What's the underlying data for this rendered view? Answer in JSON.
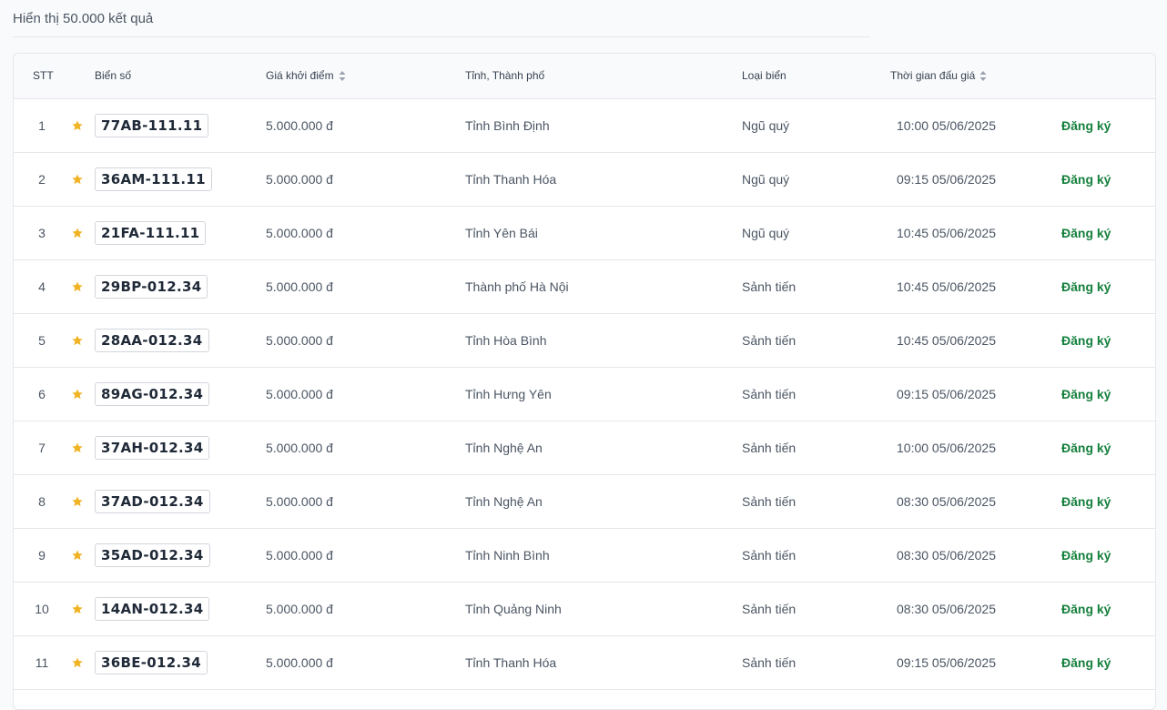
{
  "header": {
    "result_count": "Hiển thị 50.000 kết quả"
  },
  "table": {
    "columns": {
      "stt": "STT",
      "plate": "Biển số",
      "price": "Giá khởi điểm",
      "province": "Tỉnh, Thành phố",
      "type": "Loại biển",
      "time": "Thời gian đấu giá"
    },
    "rows": [
      {
        "stt": "1",
        "plate": "77AB-111.11",
        "price": "5.000.000 đ",
        "province": "Tỉnh Bình Định",
        "type": "Ngũ quý",
        "time": "10:00 05/06/2025",
        "action": "Đăng ký"
      },
      {
        "stt": "2",
        "plate": "36AM-111.11",
        "price": "5.000.000 đ",
        "province": "Tỉnh Thanh Hóa",
        "type": "Ngũ quý",
        "time": "09:15 05/06/2025",
        "action": "Đăng ký"
      },
      {
        "stt": "3",
        "plate": "21FA-111.11",
        "price": "5.000.000 đ",
        "province": "Tỉnh Yên Bái",
        "type": "Ngũ quý",
        "time": "10:45 05/06/2025",
        "action": "Đăng ký"
      },
      {
        "stt": "4",
        "plate": "29BP-012.34",
        "price": "5.000.000 đ",
        "province": "Thành phố Hà Nội",
        "type": "Sảnh tiến",
        "time": "10:45 05/06/2025",
        "action": "Đăng ký"
      },
      {
        "stt": "5",
        "plate": "28AA-012.34",
        "price": "5.000.000 đ",
        "province": "Tỉnh Hòa Bình",
        "type": "Sảnh tiến",
        "time": "10:45 05/06/2025",
        "action": "Đăng ký"
      },
      {
        "stt": "6",
        "plate": "89AG-012.34",
        "price": "5.000.000 đ",
        "province": "Tỉnh Hưng Yên",
        "type": "Sảnh tiến",
        "time": "09:15 05/06/2025",
        "action": "Đăng ký"
      },
      {
        "stt": "7",
        "plate": "37AH-012.34",
        "price": "5.000.000 đ",
        "province": "Tỉnh Nghệ An",
        "type": "Sảnh tiến",
        "time": "10:00 05/06/2025",
        "action": "Đăng ký"
      },
      {
        "stt": "8",
        "plate": "37AD-012.34",
        "price": "5.000.000 đ",
        "province": "Tỉnh Nghệ An",
        "type": "Sảnh tiến",
        "time": "08:30 05/06/2025",
        "action": "Đăng ký"
      },
      {
        "stt": "9",
        "plate": "35AD-012.34",
        "price": "5.000.000 đ",
        "province": "Tỉnh Ninh Bình",
        "type": "Sảnh tiến",
        "time": "08:30 05/06/2025",
        "action": "Đăng ký"
      },
      {
        "stt": "10",
        "plate": "14AN-012.34",
        "price": "5.000.000 đ",
        "province": "Tỉnh Quảng Ninh",
        "type": "Sảnh tiến",
        "time": "08:30 05/06/2025",
        "action": "Đăng ký"
      },
      {
        "stt": "11",
        "plate": "36BE-012.34",
        "price": "5.000.000 đ",
        "province": "Tỉnh Thanh Hóa",
        "type": "Sảnh tiến",
        "time": "09:15 05/06/2025",
        "action": "Đăng ký"
      }
    ]
  },
  "icons": {
    "favorite": "star-icon",
    "sort": "sort-icon"
  },
  "colors": {
    "accent_green": "#15803d",
    "star": "#f0b323"
  }
}
